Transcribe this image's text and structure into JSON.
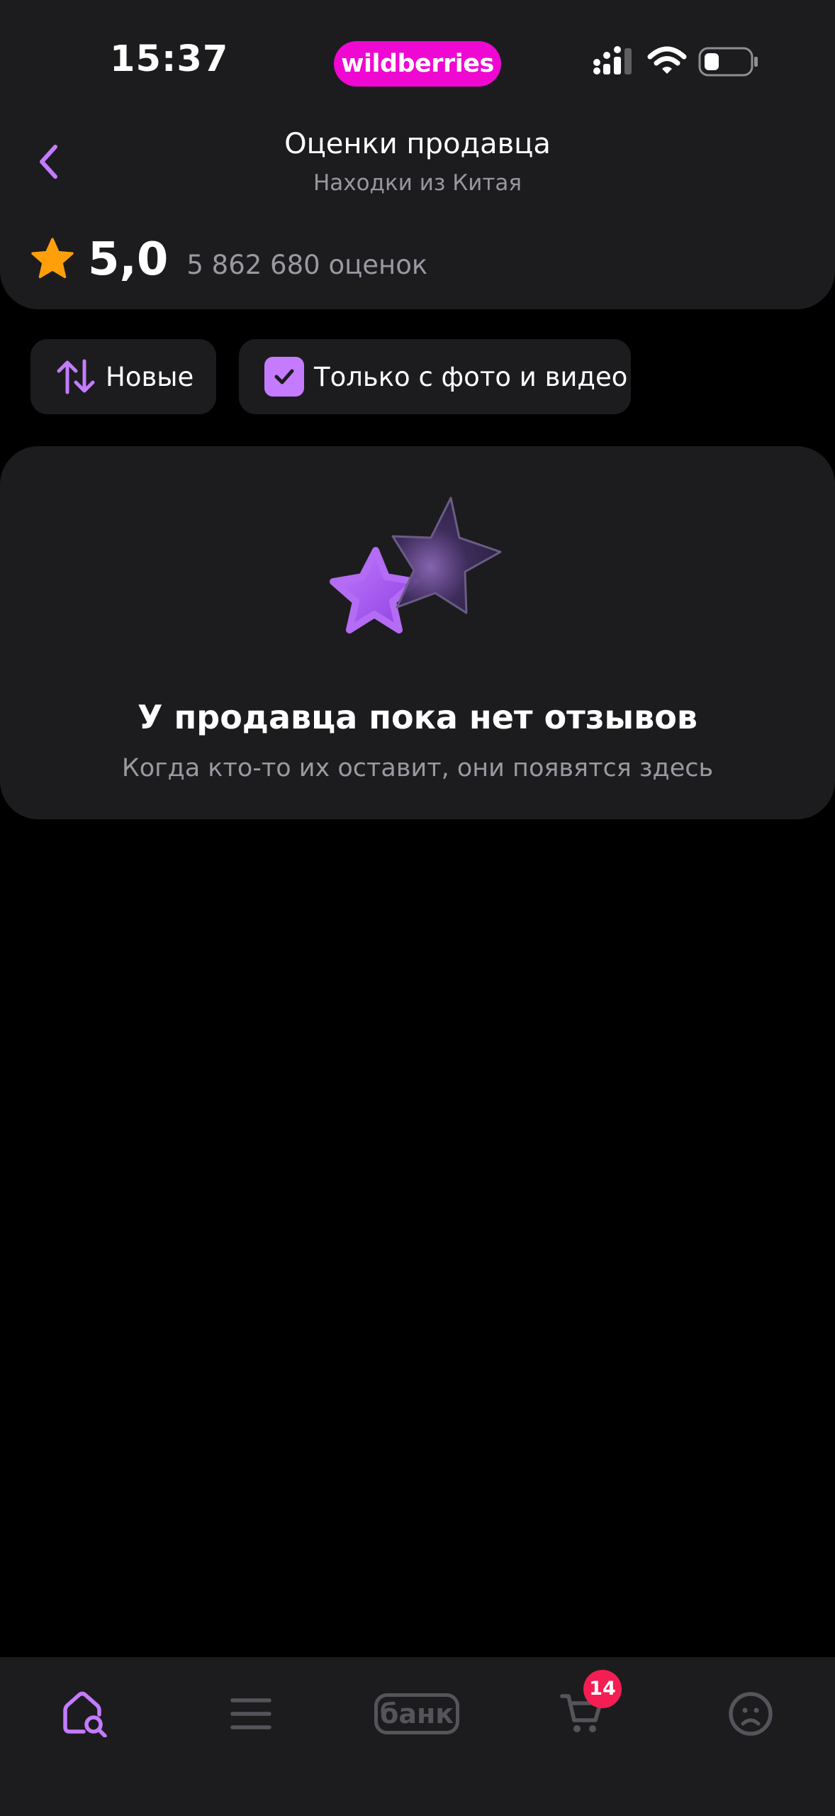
{
  "status_bar": {
    "time": "15:37",
    "brand": "wildberries"
  },
  "header": {
    "title": "Оценки продавца",
    "subtitle": "Находки из Китая"
  },
  "rating": {
    "value": "5,0",
    "count": "5 862 680 оценок"
  },
  "filters": {
    "sort_label": "Новые",
    "photo_filter_label": "Только с фото и видео",
    "photo_filter_checked": true
  },
  "empty_state": {
    "title": "У продавца пока нет отзывов",
    "text": "Когда кто-то их оставит, они появятся здесь"
  },
  "tab_bar": {
    "bank_label": "банк",
    "cart_badge": "14"
  },
  "colors": {
    "accent": "#c47bff",
    "brand": "#ee08d2",
    "star": "#ff9f0a",
    "badge": "#f41e54",
    "card_bg": "#1c1c1e"
  }
}
